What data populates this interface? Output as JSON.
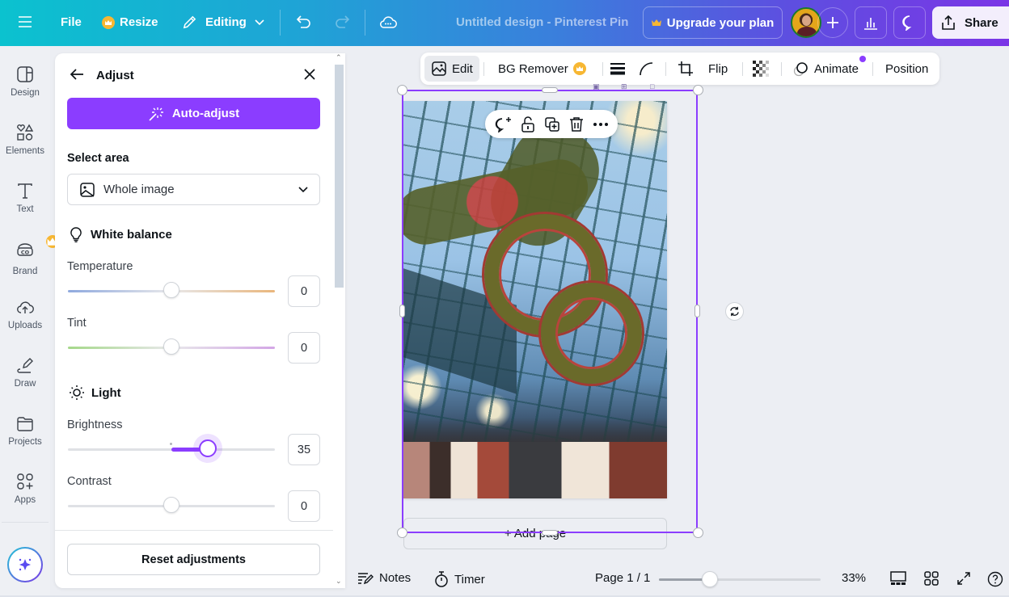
{
  "topbar": {
    "menu_icon": "hamburger-icon",
    "file_label": "File",
    "resize_label": "Resize",
    "editing_label": "Editing",
    "doc_title": "Untitled design - Pinterest Pin",
    "upgrade_label": "Upgrade your plan",
    "share_label": "Share",
    "brand_gradient": [
      "#0bc2cf",
      "#7b35e6"
    ]
  },
  "rail": {
    "items": [
      {
        "label": "Design",
        "icon": "layout-icon"
      },
      {
        "label": "Elements",
        "icon": "shapes-icon"
      },
      {
        "label": "Text",
        "icon": "text-icon"
      },
      {
        "label": "Brand",
        "icon": "brand-icon"
      },
      {
        "label": "Uploads",
        "icon": "cloud-upload-icon"
      },
      {
        "label": "Draw",
        "icon": "pen-icon"
      },
      {
        "label": "Projects",
        "icon": "folder-icon"
      },
      {
        "label": "Apps",
        "icon": "apps-icon"
      }
    ]
  },
  "panel": {
    "title": "Adjust",
    "auto_adjust_label": "Auto-adjust",
    "select_area_label": "Select area",
    "select_area_value": "Whole image",
    "white_balance_label": "White balance",
    "light_label": "Light",
    "sliders": [
      {
        "label": "Temperature",
        "value": "0",
        "min": -100,
        "max": 100,
        "current": 0
      },
      {
        "label": "Tint",
        "value": "0",
        "min": -100,
        "max": 100,
        "current": 0
      },
      {
        "label": "Brightness",
        "value": "35",
        "min": -100,
        "max": 100,
        "current": 35
      },
      {
        "label": "Contrast",
        "value": "0",
        "min": -100,
        "max": 100,
        "current": 0
      }
    ],
    "reset_label": "Reset adjustments",
    "accent_color": "#8b3dff"
  },
  "context_toolbar": {
    "edit_label": "Edit",
    "bg_remover_label": "BG Remover",
    "flip_label": "Flip",
    "animate_label": "Animate",
    "position_label": "Position"
  },
  "canvas": {
    "add_page_label": "+ Add page"
  },
  "footer": {
    "notes_label": "Notes",
    "timer_label": "Timer",
    "page_label": "Page 1 / 1",
    "zoom_label": "33%",
    "zoom_fraction": 0.33
  }
}
